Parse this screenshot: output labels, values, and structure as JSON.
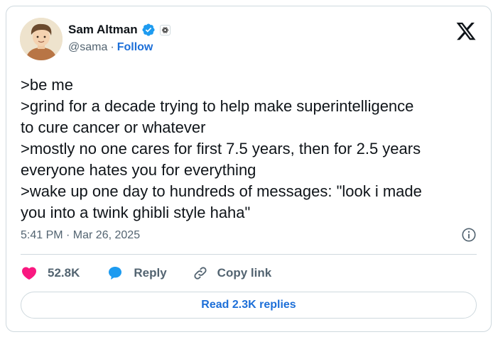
{
  "author": {
    "name": "Sam Altman",
    "handle": "@sama",
    "separator": "·",
    "follow_label": "Follow"
  },
  "tweet": {
    "lines": [
      ">be me",
      ">grind for a decade trying to help make superintelligence",
      "to cure cancer or whatever",
      ">mostly no one cares for first 7.5 years, then for 2.5 years",
      "everyone hates you for everything",
      ">wake up one day to hundreds of messages: \"look i made",
      "you into a twink ghibli style haha\""
    ],
    "timestamp": "5:41 PM · Mar 26, 2025"
  },
  "actions": {
    "like_count": "52.8K",
    "reply_label": "Reply",
    "copy_link_label": "Copy link"
  },
  "read_replies_label": "Read 2.3K replies",
  "colors": {
    "accent": "#1d6fd8",
    "like": "#f91880",
    "verified": "#1d9bf0",
    "secondary_text": "#536471",
    "border": "#cfd9de"
  },
  "icons": {
    "verified": "verified-badge-icon",
    "affiliate": "openai-affiliate-icon",
    "x_logo": "x-logo-icon",
    "info": "info-icon",
    "like": "heart-icon",
    "reply": "reply-bubble-icon",
    "link": "link-icon"
  }
}
